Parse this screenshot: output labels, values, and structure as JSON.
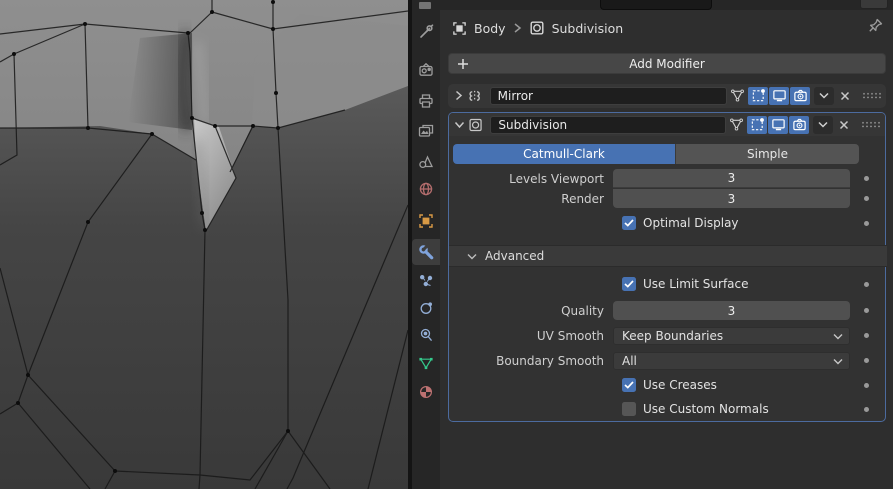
{
  "colors": {
    "accent_blue": "#4772b3",
    "active_panel_border": "#4c6b9f",
    "selected_tab_bg": "#3d3d3d",
    "object_icon_orange": "#d99a45",
    "data_icon_green": "#35c98c",
    "world_icon_red": "#b36d6d",
    "material_icon_red": "#bd7272",
    "modifier_wrench_blue": "#7fa3dc"
  },
  "breadcrumb": {
    "object_name": "Body",
    "modifier_name": "Subdivision"
  },
  "toolbar": {
    "add_modifier_label": "Add Modifier"
  },
  "properties_tabs": {
    "active": "modifiers",
    "order": [
      "tool",
      "render",
      "output",
      "view-layer",
      "scene",
      "world",
      "object",
      "modifiers",
      "particles",
      "physics",
      "constraints",
      "object-data",
      "material"
    ]
  },
  "modifiers": {
    "mirror": {
      "name": "Mirror",
      "expanded": false
    },
    "subdivision": {
      "name": "Subdivision",
      "expanded": true,
      "algorithm_options": [
        "Catmull-Clark",
        "Simple"
      ],
      "active_algorithm": "Catmull-Clark",
      "catmull_clark_active": true,
      "simple_active": false,
      "levels_viewport_label": "Levels Viewport",
      "levels_viewport_value": "3",
      "render_label": "Render",
      "render_value": "3",
      "optimal_display_label": "Optimal Display",
      "optimal_display_checked": true,
      "advanced_label": "Advanced",
      "use_limit_surface_label": "Use Limit Surface",
      "use_limit_surface_checked": true,
      "quality_label": "Quality",
      "quality_value": "3",
      "uv_smooth_label": "UV Smooth",
      "uv_smooth_value": "Keep Boundaries",
      "boundary_smooth_label": "Boundary Smooth",
      "boundary_smooth_value": "All",
      "use_creases_label": "Use Creases",
      "use_creases_checked": true,
      "use_custom_normals_label": "Use Custom Normals",
      "use_custom_normals_checked": false
    }
  }
}
